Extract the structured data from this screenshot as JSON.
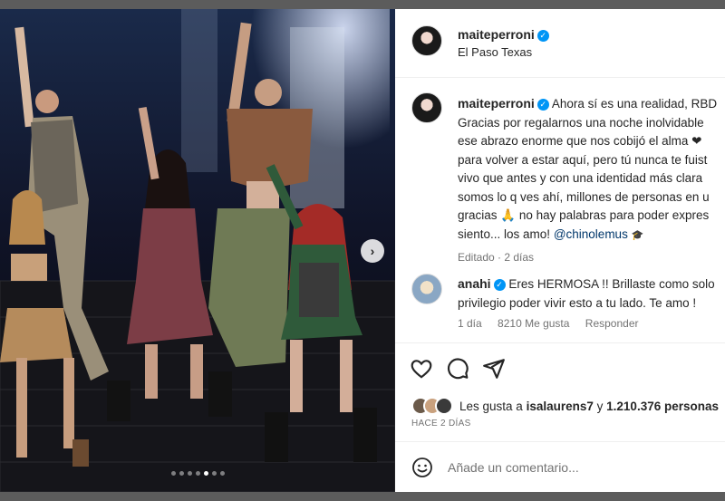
{
  "post": {
    "author": "maiteperroni",
    "location": "El Paso Texas",
    "caption_lines": [
      "Ahora sí es una realidad, RBD",
      "Gracias por regalarnos una noche inolvidable",
      "ese abrazo enorme que nos cobijó el alma ❤",
      "para volver a estar aquí, pero tú nunca te fuist",
      "vivo que antes y con una identidad más clara",
      "somos lo q ves ahí, millones de personas en u",
      "gracias 🙏 no hay palabras para poder expres",
      "siento... los amo!"
    ],
    "caption_mention": "@chinolemus",
    "caption_meta": "Editado · 2 días"
  },
  "comment": {
    "author": "anahi",
    "line1": "Eres HERMOSA !! Brillaste como solo",
    "line2": "privilegio poder vivir esto a tu lado. Te amo !",
    "time": "1 día",
    "likes": "8210 Me gusta",
    "reply": "Responder"
  },
  "likes": {
    "prefix": "Les gusta a",
    "user": "isalaurens7",
    "joiner": "y",
    "count": "1.210.376 personas"
  },
  "time_ago": "HACE 2 DÍAS",
  "add_comment_placeholder": "Añade un comentario...",
  "carousel": {
    "count": 7,
    "active_index": 4
  },
  "colors": {
    "verified": "#0095f6",
    "mention": "#00376b",
    "meta": "#737373"
  },
  "icons": [
    "heart-icon",
    "comment-icon",
    "share-icon",
    "emoji-icon",
    "chevron-right-icon",
    "verified-icon"
  ]
}
